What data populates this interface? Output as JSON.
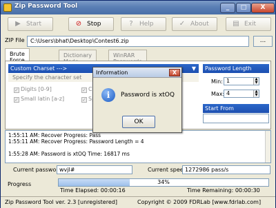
{
  "window": {
    "title": "Zip Password Tool",
    "minimize": "_",
    "maximize": "□",
    "close": "X"
  },
  "toolbar": {
    "start": "Start",
    "stop": "Stop",
    "help": "Help",
    "about": "About",
    "exit": "Exit"
  },
  "zip": {
    "label": "ZIP File",
    "path": "C:\\Users\\bhat\\Desktop\\Contest6.zip",
    "browse_label": "..."
  },
  "tabs": [
    "Brute Force Mode",
    "Dictionary Mode",
    "WinRAR Passwords"
  ],
  "charset": {
    "header": "Custom Charset  --->",
    "specify": "Specify the character set",
    "options": [
      {
        "label": "Digits [0-9]",
        "checked": true
      },
      {
        "label": "Small latin [a-z]",
        "checked": true
      },
      {
        "label": "Ca",
        "checked": true
      },
      {
        "label": "Sp",
        "checked": true
      }
    ]
  },
  "password_length": {
    "header": "Password Length",
    "min_label": "Min:",
    "min": "1",
    "max_label": "Max:",
    "max": "4"
  },
  "start_from": {
    "header": "Start From",
    "value": ""
  },
  "log": [
    "1:55:11 AM: Recover Progress: Pass",
    "1:55:11 AM: Recover Progress: Password Length = 4",
    "",
    "1:55:28 AM: Password is xtOQ  Time: 16817 ms"
  ],
  "current": {
    "password_label": "Current password",
    "password": "wvjl#",
    "speed_label": "Current speed",
    "speed": "1272986 pass/s"
  },
  "progress": {
    "label": "Progress",
    "percent_text": "34%",
    "fraction": 0.34,
    "elapsed": "Time Elapsed: 00:00:16",
    "remaining": "Time Remaining: 00:00:30"
  },
  "status": {
    "left": "Zip Password Tool ver. 2.3 [unregistered]",
    "right": "Copyright © 2009 FDRLab [www.fdrlab.com]"
  },
  "dialog": {
    "title": "Information",
    "message": "Password is xtOQ",
    "ok": "OK",
    "close": "X",
    "icon": "info-icon"
  }
}
